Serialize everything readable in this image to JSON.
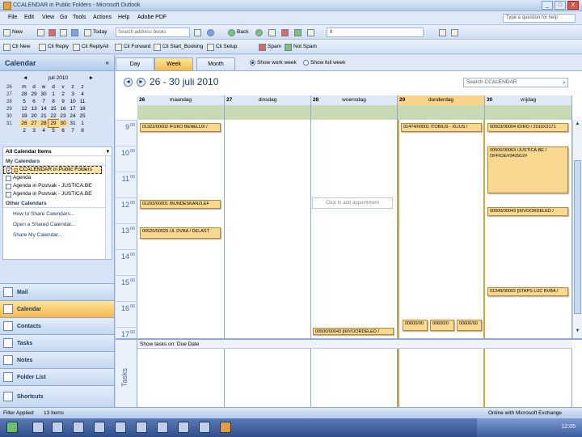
{
  "window": {
    "title": "CCALENDAR in Public Folders - Microsoft Outlook",
    "buttons": [
      "_",
      "□",
      "X"
    ]
  },
  "menu": [
    "File",
    "Edit",
    "View",
    "Go",
    "Tools",
    "Actions",
    "Help",
    "Adobe PDF"
  ],
  "help_box": "Type a question for help",
  "toolbar1": {
    "new": "New",
    "today": "Today",
    "address_search": "Search address books",
    "back": "Back",
    "find_value": "II"
  },
  "toolbar2": [
    "Cli New",
    "Cli Reply",
    "Cli ReplyAll",
    "Cli Forward",
    "Cli Start_Booking",
    "Cli Setup",
    "Spam",
    "Not Spam"
  ],
  "nav": {
    "header": "Calendar",
    "mini_cal": {
      "month": "juli 2010",
      "prev": "◄",
      "next": "►",
      "weekdays": [
        "m",
        "d",
        "w",
        "d",
        "v",
        "z",
        "z"
      ],
      "weeknums": [
        "26",
        "27",
        "28",
        "29",
        "30",
        "31"
      ],
      "days": [
        "28",
        "29",
        "30",
        "1",
        "2",
        "3",
        "4",
        "5",
        "6",
        "7",
        "8",
        "9",
        "10",
        "11",
        "12",
        "13",
        "14",
        "15",
        "16",
        "17",
        "18",
        "19",
        "20",
        "21",
        "22",
        "23",
        "24",
        "25",
        "26",
        "27",
        "28",
        "29",
        "30",
        "31",
        "1",
        "2",
        "3",
        "4",
        "5",
        "6",
        "7",
        "8"
      ]
    },
    "list_header": "All Calendar Items",
    "my_calendars": "My Calendars",
    "calendars": [
      "CCALENDAR in Public Folders",
      "Agenda",
      "Agenda in Postvak - JUSTICA.BE",
      "Agenda in Postvak - JUSTICA.BE"
    ],
    "other_calendars": "Other Calendars",
    "links": [
      "How to Share Calendars...",
      "Open a Shared Calendar...",
      "Share My Calendar..."
    ],
    "buttons": [
      "Mail",
      "Calendar",
      "Contacts",
      "Tasks",
      "Notes",
      "Folder List",
      "Shortcuts"
    ]
  },
  "view": {
    "tabs": [
      "Day",
      "Week",
      "Month"
    ],
    "active_tab": "Week",
    "radio1": "Show work week",
    "radio2": "Show full week",
    "date_range": "26 - 30 juli 2010",
    "search_placeholder": "Search CCALENDAR",
    "prev": "◄",
    "next": "►"
  },
  "days": [
    {
      "num": "26",
      "name": "maandag"
    },
    {
      "num": "27",
      "name": "dinsdag"
    },
    {
      "num": "28",
      "name": "woensdag"
    },
    {
      "num": "29",
      "name": "donderdag"
    },
    {
      "num": "30",
      "name": "vrijdag"
    }
  ],
  "hours": [
    "9",
    "10",
    "11",
    "12",
    "13",
    "14",
    "15",
    "16",
    "17"
  ],
  "minutes": "00",
  "appointments": {
    "mon_9": "01322/00002 /FUKO BENELUX /",
    "mon_12": "01293/00001 /BUNDESKANZLEF",
    "mon_13": "00520/00029 /JL DVBA / DELAST",
    "thu_9": "01474/00001 /TOBIUS - XLIUS /",
    "fri_9": "00503/00004 IDIRO / 2010X3171",
    "fri_10": "00506/00063 /JUSTICA.BE / OFFICE/#342912#",
    "fri_12": "00500/00043 [III/VOORDELED /",
    "fri_16": "01349/00002 [STAPS LUC BVBA /",
    "wed_17": "00500/00043 [III/VOORDELED /",
    "thu_17a": "00600/00",
    "thu_17b": "00600/0",
    "fri_17": "00600/00"
  },
  "click_add": "Click to add appointment",
  "tasks": {
    "label": "Tasks",
    "header": "Show tasks on: Due Date"
  },
  "status": {
    "filter": "Filter Applied",
    "items": "13 Items",
    "exchange": "Online with Microsoft Exchange"
  },
  "clock": "12:05"
}
